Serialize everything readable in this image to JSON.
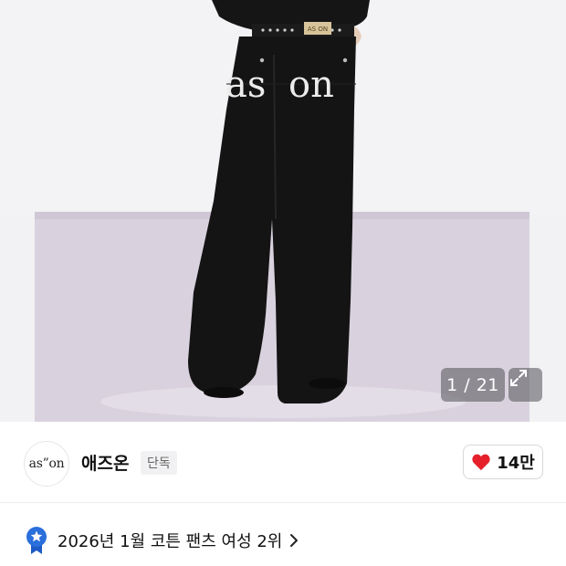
{
  "gallery": {
    "counter": "1 / 21",
    "print_left": "as",
    "print_right": "on",
    "tag_text": "AS ON"
  },
  "brand": {
    "logo_text": "as”on",
    "name": "애즈온",
    "badge": "단독"
  },
  "like": {
    "count": "14만",
    "icon_color": "#e5202b"
  },
  "ranking": {
    "text": "2026년 1월 코튼 팬츠 여성 2위",
    "badge_color": "#2a6fdb"
  },
  "icons": {
    "expand": "expand-icon",
    "heart": "heart-icon",
    "rank_badge": "ranking-badge-icon",
    "chevron": "chevron-right-icon"
  }
}
